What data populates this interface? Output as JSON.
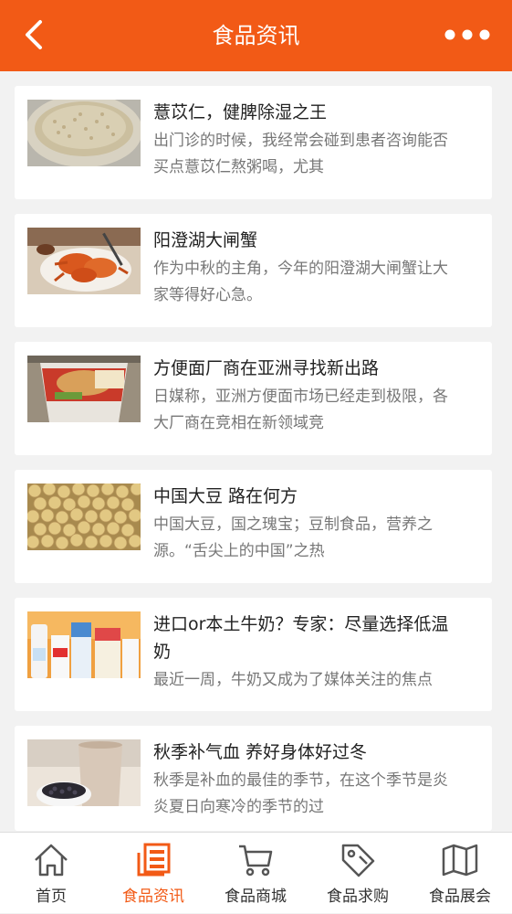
{
  "header": {
    "title": "食品资讯",
    "accent_color": "#f25a16",
    "back_icon": "chevron-left-icon",
    "more_icon": "more-dots-icon"
  },
  "articles": [
    {
      "title": "薏苡仁，健脾除湿之王",
      "desc": "出门诊的时候，我经常会碰到患者咨询能否买点薏苡仁熬粥喝，尤其",
      "image": "barley-grains-photo"
    },
    {
      "title": "阳澄湖大闸蟹",
      "desc": "作为中秋的主角，今年的阳澄湖大闸蟹让大家等得好心急。",
      "image": "hairy-crabs-photo"
    },
    {
      "title": "方便面厂商在亚洲寻找新出路",
      "desc": "日媒称，亚洲方便面市场已经走到极限，各大厂商在竞相在新领域竞",
      "image": "instant-noodle-cup-photo"
    },
    {
      "title": "中国大豆 路在何方",
      "desc": "中国大豆，国之瑰宝；豆制食品，营养之源。“舌尖上的中国”之热",
      "image": "soybeans-photo"
    },
    {
      "title": "进口or本土牛奶？专家：尽量选择低温奶",
      "desc": "最近一周，牛奶又成为了媒体关注的焦点",
      "image": "milk-cartons-photo"
    },
    {
      "title": "秋季补气血 养好身体好过冬",
      "desc": "秋季是补血的最佳的季节，在这个季节是炎炎夏日向寒冷的季节的过",
      "image": "black-beans-drink-photo"
    }
  ],
  "tabbar": [
    {
      "label": "首页",
      "icon": "home-icon",
      "active": false
    },
    {
      "label": "食品资讯",
      "icon": "news-icon",
      "active": true
    },
    {
      "label": "食品商城",
      "icon": "cart-icon",
      "active": false
    },
    {
      "label": "食品求购",
      "icon": "tag-icon",
      "active": false
    },
    {
      "label": "食品展会",
      "icon": "map-icon",
      "active": false
    }
  ]
}
